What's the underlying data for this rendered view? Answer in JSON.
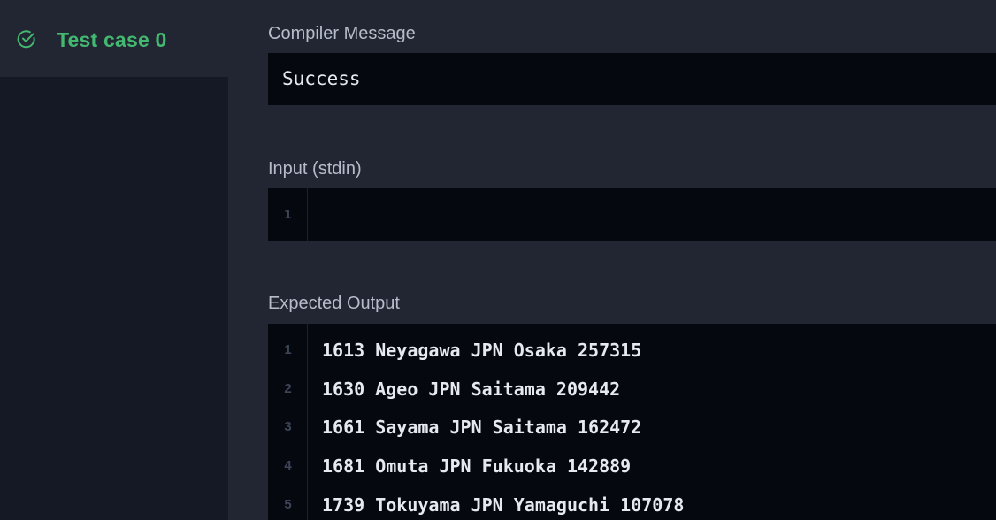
{
  "sidebar": {
    "test_case_label": "Test case 0",
    "status_color": "#42b870",
    "status_icon": "check-circle-icon"
  },
  "compiler": {
    "title": "Compiler Message",
    "message": "Success"
  },
  "input": {
    "title": "Input (stdin)",
    "line_numbers": [
      "1"
    ],
    "lines": [
      ""
    ]
  },
  "expected_output": {
    "title": "Expected Output",
    "line_numbers": [
      "1",
      "2",
      "3",
      "4",
      "5"
    ],
    "lines": [
      "1613 Neyagawa JPN Osaka 257315",
      "1630 Ageo JPN Saitama 209442",
      "1661 Sayama JPN Saitama 162472",
      "1681 Omuta JPN Fukuoka 142889",
      "1739 Tokuyama JPN Yamaguchi 107078"
    ]
  }
}
